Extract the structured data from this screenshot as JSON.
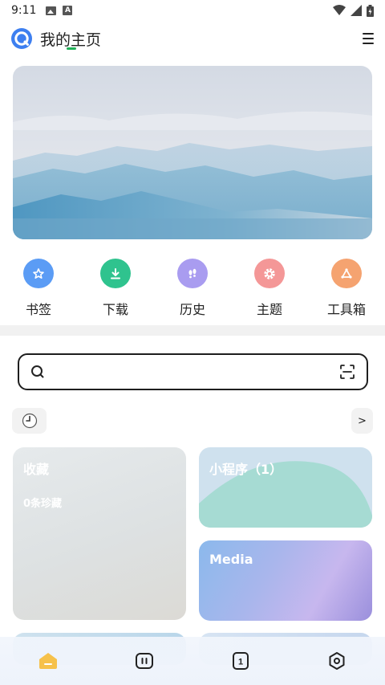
{
  "status_bar": {
    "time": "9:11"
  },
  "header": {
    "title": "我的主页"
  },
  "shortcuts": [
    {
      "label": "书签",
      "icon": "bookmark-star-icon",
      "color": "#5b9cf5"
    },
    {
      "label": "下载",
      "icon": "download-icon",
      "color": "#2fc38e"
    },
    {
      "label": "历史",
      "icon": "footprints-icon",
      "color": "#a99cf0"
    },
    {
      "label": "主题",
      "icon": "theme-gear-icon",
      "color": "#f49797"
    },
    {
      "label": "工具箱",
      "icon": "toolbox-icon",
      "color": "#f5a370"
    }
  ],
  "search": {
    "placeholder": ""
  },
  "history": {
    "more_label": ">"
  },
  "cards": {
    "favorites": {
      "title": "收藏",
      "subtitle": "0条珍藏"
    },
    "mini_programs": {
      "title": "小程序（1）"
    },
    "media": {
      "title": "Media"
    }
  },
  "bottom_nav": [
    "home-icon",
    "tabs-icon",
    "window-count-icon",
    "settings-icon"
  ],
  "colors": {
    "accent_green": "#20b058",
    "nav_home_active": "#f6c14b"
  }
}
